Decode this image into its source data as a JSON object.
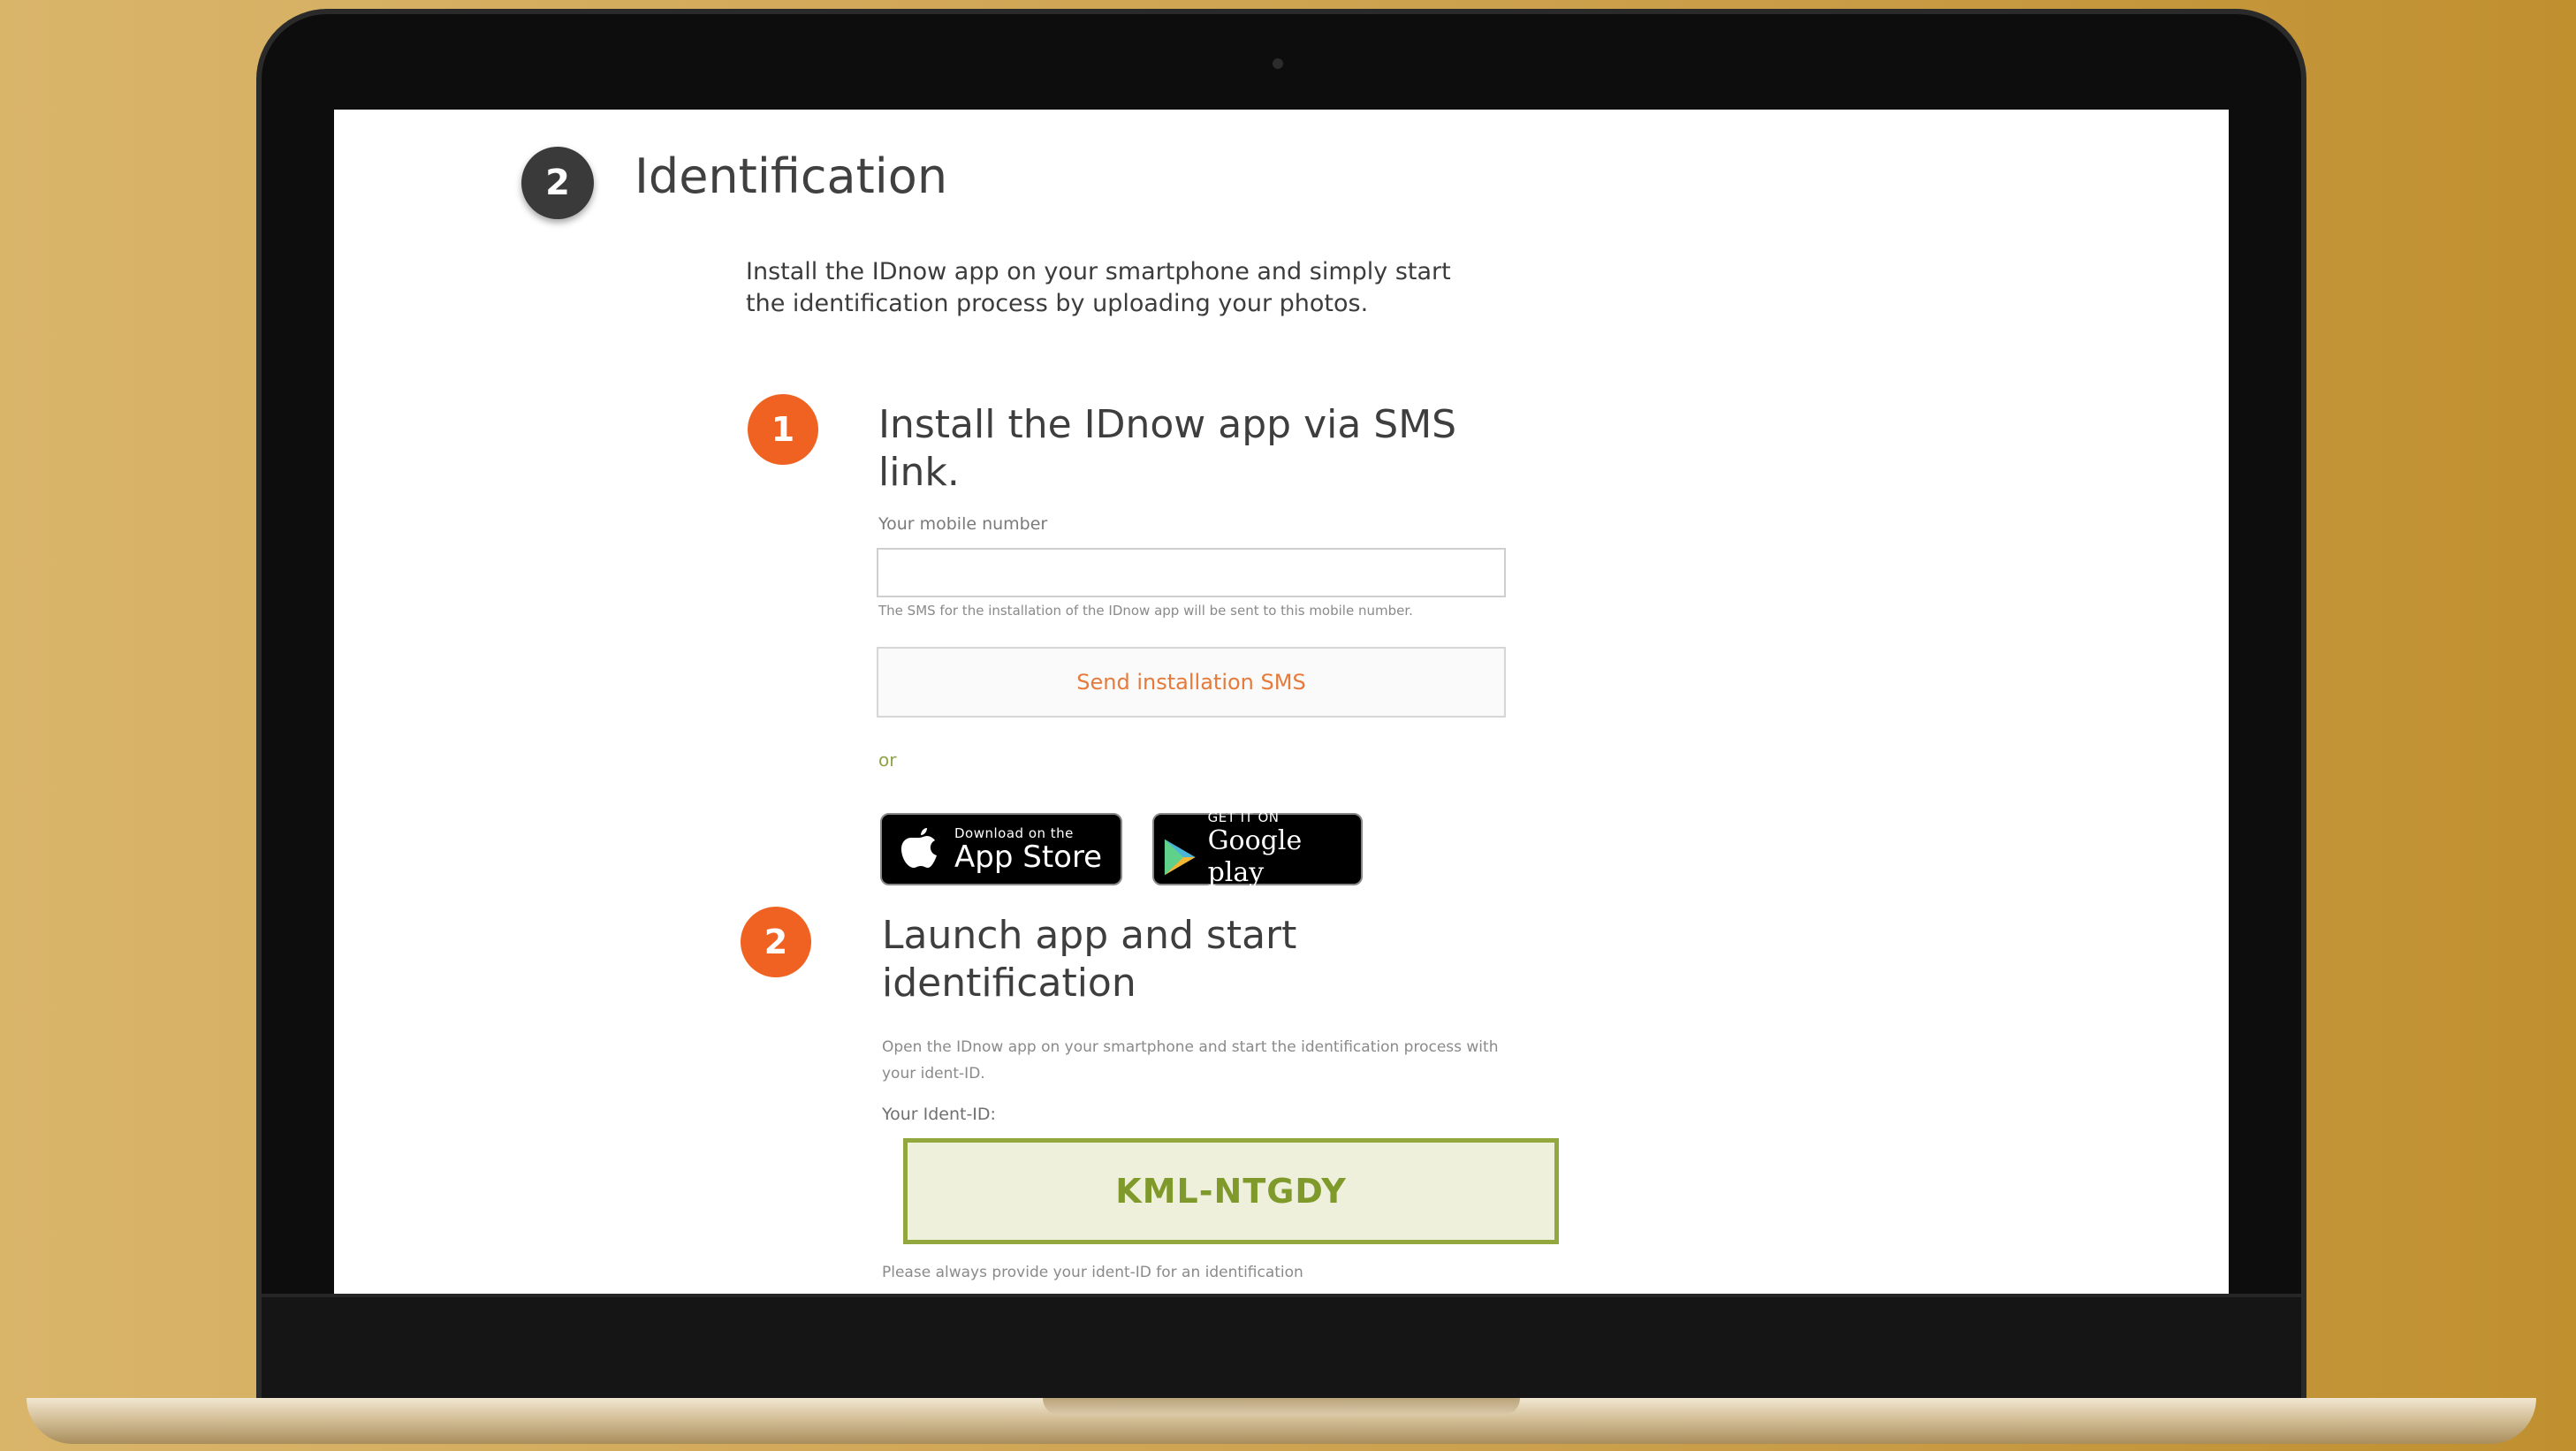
{
  "section": {
    "number": "2",
    "title": "Identification"
  },
  "intro_lines": [
    "Install the IDnow app on your smartphone and simply start",
    "the identification process by uploading your photos."
  ],
  "step1": {
    "number": "1",
    "title_lines": [
      "Install the IDnow app via SMS",
      "link."
    ],
    "mobile_label": "Your mobile number",
    "mobile_value": "",
    "mobile_hint": "The SMS for the installation of the IDnow app will be sent to this mobile number.",
    "send_button": "Send installation SMS",
    "or_text": "or",
    "app_store": {
      "small": "Download on the",
      "large": "App Store",
      "icon": "apple-icon"
    },
    "google_play": {
      "small": "GET IT ON",
      "large": "Google play",
      "icon": "play-triangle-icon"
    }
  },
  "step2": {
    "number": "2",
    "title_lines": [
      "Launch app and start",
      "identification"
    ],
    "desc_lines": [
      "Open the IDnow app on your smartphone and start the identification process with",
      "your ident-ID."
    ],
    "ident_label": "Your Ident-ID:",
    "ident_id": "KML-NTGDY",
    "ident_hint": "Please always provide your ident-ID for an identification"
  },
  "colors": {
    "accent_orange": "#f06222",
    "ident_green": "#92a83e",
    "dark_badge": "#3a3a3a"
  }
}
